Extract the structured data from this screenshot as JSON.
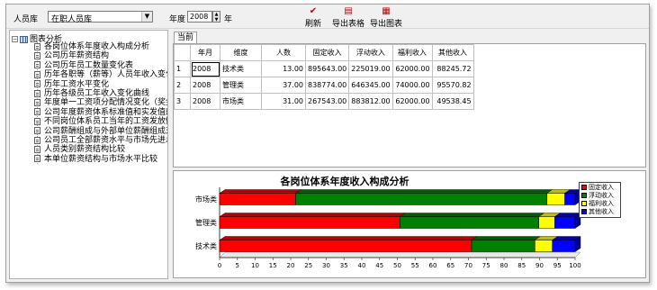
{
  "toolbar": {
    "staff_label": "人员库",
    "staff_value": "在职人员库",
    "year_label": "年度",
    "year_value": "2008",
    "year_unit": "年",
    "refresh_label": "刷新",
    "export_table_label": "导出表格",
    "export_chart_label": "导出图表"
  },
  "tree": {
    "root": "图表分析",
    "items": [
      "各岗位体系年度收入构成分析",
      "公司历年薪资结构",
      "公司历年员工数量变化表",
      "历年各职等（薪等）人员年收入变化情",
      "历年工资水平变化",
      "历年各级员工年收入变化曲线",
      "年度单一工资项分配情况变化（奖金）",
      "公司年度薪资体系标准值和实发值的比",
      "不同岗位体系员工当年的工资发放情况",
      "公司薪酬组成与外部单位薪酬组成对比",
      "公司员工全部薪资水平与市场先进总收",
      "人员类别薪资结构比较",
      "本单位薪资结构与市场水平比较"
    ]
  },
  "tab": {
    "label": "当前"
  },
  "table": {
    "headers": [
      "",
      "年月",
      "维度",
      "人数",
      "固定收入",
      "浮动收入",
      "福利收入",
      "其他收入"
    ],
    "rows": [
      [
        "1",
        "2008",
        "技术类",
        "13.00",
        "895643.00",
        "225019.00",
        "62000.00",
        "88245.72"
      ],
      [
        "2",
        "2008",
        "管理类",
        "37.00",
        "838774.00",
        "646345.00",
        "74000.00",
        "95570.82"
      ],
      [
        "3",
        "2008",
        "市场类",
        "31.00",
        "267543.00",
        "883812.00",
        "62000.00",
        "49538.45"
      ]
    ]
  },
  "chart_data": {
    "type": "bar",
    "orientation": "horizontal",
    "stacked": true,
    "percent": true,
    "title": "各岗位体系年度收入构成分析",
    "categories": [
      "市场类",
      "管理类",
      "技术类"
    ],
    "series": [
      {
        "name": "固定收入",
        "color": "#ff0000",
        "values": [
          21.4,
          50.7,
          70.9
        ]
      },
      {
        "name": "浮动收入",
        "color": "#008000",
        "values": [
          70.7,
          39.1,
          17.8
        ]
      },
      {
        "name": "福利收入",
        "color": "#ffff00",
        "values": [
          5.0,
          4.5,
          4.9
        ]
      },
      {
        "name": "其他收入",
        "color": "#0000ff",
        "values": [
          4.0,
          5.8,
          7.0
        ]
      }
    ],
    "x_ticks": [
      "0",
      "5",
      "10",
      "15",
      "20",
      "25",
      "30",
      "35",
      "40",
      "45",
      "50",
      "55",
      "60",
      "65",
      "70",
      "75",
      "80",
      "85",
      "90",
      "95",
      "100"
    ],
    "xlim": [
      0,
      100
    ],
    "legend_position": "right"
  }
}
